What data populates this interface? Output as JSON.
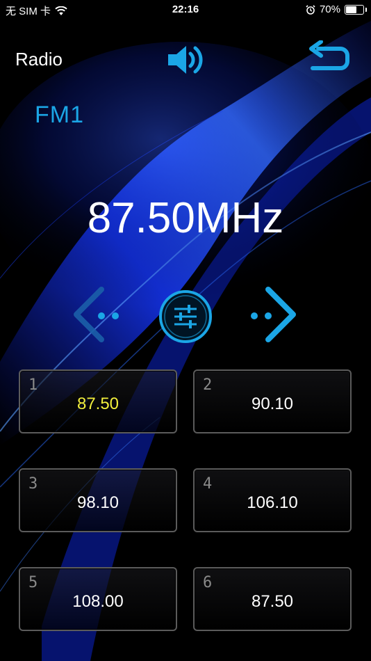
{
  "status_bar": {
    "carrier": "无 SIM 卡",
    "time": "22:16",
    "battery": "70%",
    "battery_level": 0.7,
    "icons": [
      "wifi-icon",
      "alarm-icon",
      "battery-icon"
    ]
  },
  "header": {
    "title": "Radio",
    "volume_icon": "speaker-volume-icon",
    "back_icon": "return-arrow-icon"
  },
  "band": "FM1",
  "frequency": "87.50MHz",
  "controls": {
    "prev_icon": "chevron-left-icon",
    "tune_icon": "sliders-icon",
    "next_icon": "chevron-right-icon"
  },
  "presets": [
    {
      "number": "1",
      "freq": "87.50",
      "active": true
    },
    {
      "number": "2",
      "freq": "90.10",
      "active": false
    },
    {
      "number": "3",
      "freq": "98.10",
      "active": false
    },
    {
      "number": "4",
      "freq": "106.10",
      "active": false
    },
    {
      "number": "5",
      "freq": "108.00",
      "active": false
    },
    {
      "number": "6",
      "freq": "87.50",
      "active": false
    }
  ],
  "colors": {
    "accent": "#1ba6e6",
    "active_preset_text": "#f2ef3c",
    "background": "#000000",
    "swoosh": "#1030d0"
  }
}
